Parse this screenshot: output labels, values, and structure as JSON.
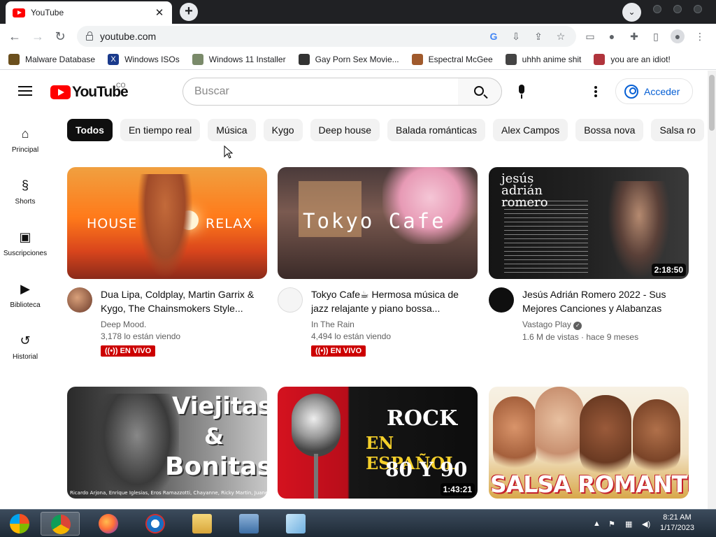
{
  "browser": {
    "tab_title": "YouTube",
    "tab_close": "✕",
    "url": "youtube.com"
  },
  "bookmarks": [
    {
      "label": "Malware Database",
      "color": "#6b4f1d"
    },
    {
      "label": "Windows ISOs",
      "color": "#1a3a8c"
    },
    {
      "label": "Windows 11 Installer",
      "color": "#7a8a6a"
    },
    {
      "label": "Gay Porn Sex Movie...",
      "color": "#333333"
    },
    {
      "label": "Espectral McGee",
      "color": "#a05a2c"
    },
    {
      "label": "uhhh anime shit",
      "color": "#444444"
    },
    {
      "label": "you are an idiot!",
      "color": "#b0343c"
    }
  ],
  "header": {
    "logo_text": "YouTube",
    "country": "CO",
    "search_placeholder": "Buscar",
    "signin_label": "Acceder"
  },
  "sidebar": {
    "items": [
      {
        "label": "Principal",
        "icon": "home-icon"
      },
      {
        "label": "Shorts",
        "icon": "shorts-icon"
      },
      {
        "label": "Suscripciones",
        "icon": "subscriptions-icon"
      },
      {
        "label": "Biblioteca",
        "icon": "library-icon"
      },
      {
        "label": "Historial",
        "icon": "history-icon"
      }
    ]
  },
  "chips": [
    "Todos",
    "En tiempo real",
    "Música",
    "Kygo",
    "Deep house",
    "Balada románticas",
    "Alex Campos",
    "Bossa nova",
    "Salsa ro"
  ],
  "videos": [
    {
      "title": "Dua Lipa, Coldplay, Martin Garrix & Kygo, The Chainsmokers Style...",
      "channel": "Deep Mood.",
      "stats": "3,178 lo están viendo",
      "live": "EN VIVO",
      "thumb_text_left": "HOUSE",
      "thumb_text_right": "RELAX"
    },
    {
      "title": "Tokyo Cafe☕ Hermosa música de jazz relajante y piano bossa...",
      "channel": "In The Rain",
      "stats": "4,494 lo están viendo",
      "live": "EN VIVO",
      "thumb_text": "Tokyo Cafe"
    },
    {
      "title": "Jesús Adrián Romero 2022 - Sus Mejores Canciones y Alabanzas",
      "channel": "Vastago Play",
      "stats": "1.6 M de vistas · hace 9 meses",
      "duration": "2:18:50",
      "thumb_text": "jesús adrián romero"
    },
    {
      "thumb_text_1": "Viejitas",
      "thumb_text_2": "&",
      "thumb_text_3": "Bonitas",
      "thumb_caption": "Ricardo Arjona, Enrique Iglesias, Eros Ramazzotti, Chayanne, Ricky Martin, Juanes, Franco de Vita..."
    },
    {
      "duration": "1:43:21",
      "thumb_text_1": "ROCK",
      "thumb_text_2": "EN ESPAÑOL",
      "thumb_text_3": "80 Y 90"
    },
    {
      "thumb_text": "SALSA ROMANTICA"
    }
  ],
  "taskbar": {
    "time": "8:21 AM",
    "date": "1/17/2023"
  }
}
